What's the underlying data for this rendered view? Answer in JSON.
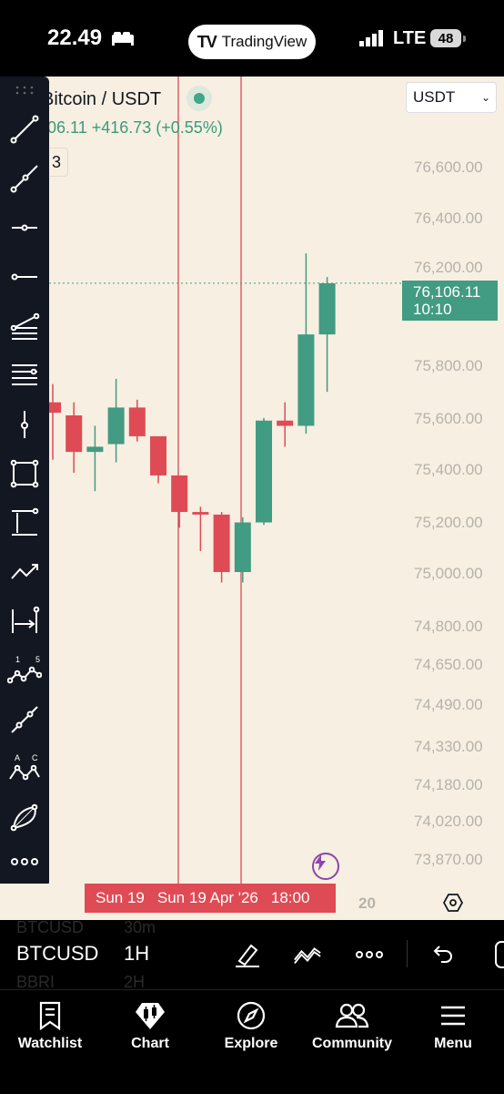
{
  "status_bar": {
    "time": "22.49",
    "app_pill": "TradingView",
    "network": "LTE",
    "battery": "48"
  },
  "chart": {
    "pair_title": "Bitcoin / USDT",
    "price_change": "06.11  +416.73 (+0.55%)",
    "interval_chip": "3",
    "currency": "USDT",
    "y_axis_labels": [
      "76,600.00",
      "76,400.00",
      "76,200.00",
      "75,800.00",
      "75,600.00",
      "75,400.00",
      "75,200.00",
      "75,000.00",
      "74,800.00",
      "74,650.00",
      "74,490.00",
      "74,330.00",
      "74,180.00",
      "74,020.00",
      "73,870.00"
    ],
    "last_price": "76,106.11",
    "countdown": "10:10",
    "time_label_parts": [
      "Sun 19",
      "Sun 19 Apr '26",
      "18:00"
    ],
    "time_tick": "20",
    "colors": {
      "up": "#429b83",
      "down": "#df4b55",
      "background": "#f7efe1",
      "crosshair": "#d94a55"
    }
  },
  "chart_data": {
    "type": "candlestick",
    "title": "Bitcoin / USDT",
    "interval": "1H",
    "ylim": [
      73870,
      76700
    ],
    "last_price": 76106.11,
    "candles": [
      {
        "open": 75650,
        "high": 75720,
        "low": 75430,
        "close": 75610,
        "dir": "down"
      },
      {
        "open": 75600,
        "high": 75650,
        "low": 75380,
        "close": 75460,
        "dir": "down"
      },
      {
        "open": 75460,
        "high": 75560,
        "low": 75310,
        "close": 75480,
        "dir": "up"
      },
      {
        "open": 75490,
        "high": 75740,
        "low": 75420,
        "close": 75630,
        "dir": "up"
      },
      {
        "open": 75630,
        "high": 75660,
        "low": 75500,
        "close": 75520,
        "dir": "down"
      },
      {
        "open": 75520,
        "high": 75520,
        "low": 75340,
        "close": 75370,
        "dir": "down"
      },
      {
        "open": 75370,
        "high": 75370,
        "low": 75170,
        "close": 75230,
        "dir": "down"
      },
      {
        "open": 75230,
        "high": 75250,
        "low": 75080,
        "close": 75220,
        "dir": "down"
      },
      {
        "open": 75220,
        "high": 75230,
        "low": 74960,
        "close": 75000,
        "dir": "down"
      },
      {
        "open": 75000,
        "high": 75210,
        "low": 74960,
        "close": 75190,
        "dir": "up"
      },
      {
        "open": 75190,
        "high": 75590,
        "low": 75180,
        "close": 75580,
        "dir": "up"
      },
      {
        "open": 75580,
        "high": 75650,
        "low": 75480,
        "close": 75560,
        "dir": "down"
      },
      {
        "open": 75560,
        "high": 76220,
        "low": 75530,
        "close": 75910,
        "dir": "up"
      },
      {
        "open": 75910,
        "high": 76130,
        "low": 75690,
        "close": 76106,
        "dir": "up"
      }
    ]
  },
  "drawing_tools": [
    "trend-line",
    "ray",
    "horizontal-ray",
    "horizontal-line",
    "fib-retracement",
    "parallel-lines",
    "vertical-line",
    "rectangle",
    "long-position",
    "path",
    "date-range",
    "elliott-wave",
    "extended-line",
    "abcd-pattern",
    "arc",
    "more"
  ],
  "symbol_bar": {
    "symbol": "BTCUSD",
    "interval": "1H",
    "ghost_prev_symbol": "BTCUSD",
    "ghost_prev_interval": "30m",
    "ghost_next_symbol": "BBRI",
    "ghost_next_interval": "2H"
  },
  "bottom_nav": [
    {
      "label": "Watchlist",
      "icon": "watchlist-icon"
    },
    {
      "label": "Chart",
      "icon": "chart-icon"
    },
    {
      "label": "Explore",
      "icon": "compass-icon"
    },
    {
      "label": "Community",
      "icon": "community-icon"
    },
    {
      "label": "Menu",
      "icon": "menu-icon"
    }
  ]
}
